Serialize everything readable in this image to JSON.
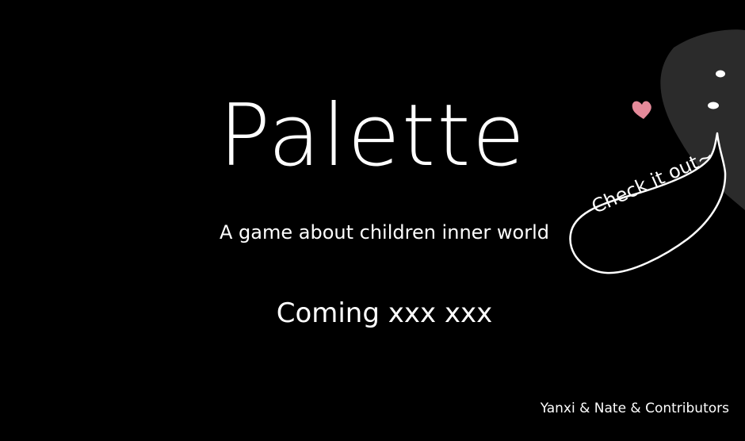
{
  "game": {
    "title": "Palette",
    "subtitle": "A game about children inner world",
    "release": "Coming xxx xxx",
    "credits": "Yanxi & Nate & Contributors",
    "speech_bubble": "Check it out~"
  },
  "icons": {
    "heart": "heart-icon",
    "creature": "shadow-creature"
  },
  "colors": {
    "background": "#000000",
    "text": "#ffffff",
    "creature": "#2b2b2b",
    "heart": "#e58a9a"
  }
}
